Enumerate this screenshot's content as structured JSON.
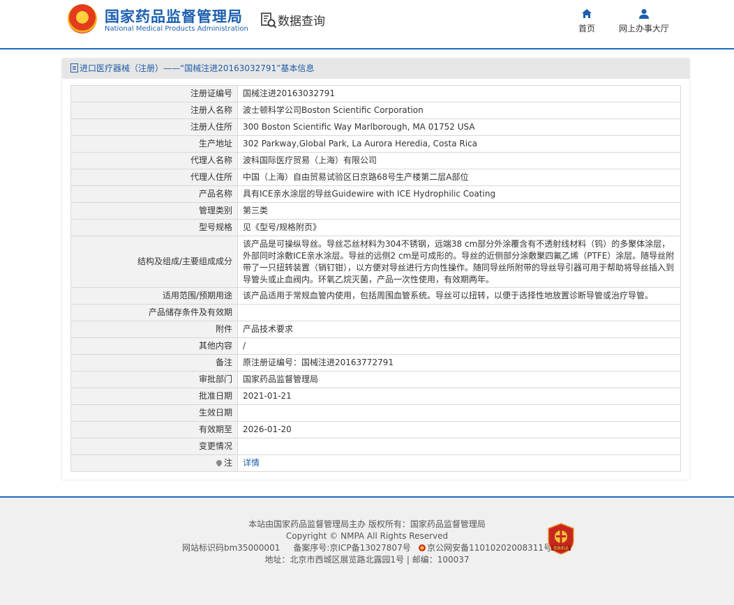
{
  "header": {
    "brand_cn": "国家药品监督管理局",
    "brand_en": "National Medical Products Administration",
    "query_label": "数据查询",
    "nav": [
      {
        "label": "首页",
        "icon": "home-icon"
      },
      {
        "label": "网上办事大厅",
        "icon": "user-icon"
      }
    ]
  },
  "panel": {
    "title": "进口医疗器械（注册）——“国械注进20163032791”基本信息",
    "rows": [
      {
        "label": "注册证编号",
        "value": "国械注进20163032791"
      },
      {
        "label": "注册人名称",
        "value": "波士顿科学公司Boston Scientific Corporation"
      },
      {
        "label": "注册人住所",
        "value": "300 Boston Scientific Way Marlborough, MA 01752 USA"
      },
      {
        "label": "生产地址",
        "value": "302 Parkway,Global Park, La Aurora Heredia, Costa Rica"
      },
      {
        "label": "代理人名称",
        "value": "波科国际医疗贸易（上海）有限公司"
      },
      {
        "label": "代理人住所",
        "value": "中国（上海）自由贸易试验区日京路68号生产楼第二层A部位"
      },
      {
        "label": "产品名称",
        "value": "具有ICE亲水涂层的导丝Guidewire with ICE Hydrophilic Coating"
      },
      {
        "label": "管理类别",
        "value": "第三类"
      },
      {
        "label": "型号规格",
        "value": "见《型号/规格附页》"
      },
      {
        "label": "结构及组成/主要组成成分",
        "value": "该产品是可操纵导丝。导丝芯丝材料为304不锈钢，远端38 cm部分外涂覆含有不透射线材料（钨）的多聚体涂层，外部同时涂敷ICE亲水涂层。导丝的远侧2 cm是可成形的。导丝的近侧部分涂敷聚四氟乙烯（PTFE）涂层。随导丝附带了一只扭转装置（销钉钳），以方便对导丝进行方向性操作。随同导丝所附带的导丝导引器可用于帮助将导丝插入到导管头或止血阀内。环氧乙烷灭菌，产品一次性使用，有效期两年。"
      },
      {
        "label": "适用范围/预期用途",
        "value": "该产品适用于常规血管内使用，包括周围血管系统。导丝可以扭转，以便于选择性地放置诊断导管或治疗导管。"
      },
      {
        "label": "产品储存条件及有效期",
        "value": ""
      },
      {
        "label": "附件",
        "value": "产品技术要求"
      },
      {
        "label": "其他内容",
        "value": "/"
      },
      {
        "label": "备注",
        "value": "原注册证编号：国械注进20163772791"
      },
      {
        "label": "审批部门",
        "value": "国家药品监督管理局"
      },
      {
        "label": "批准日期",
        "value": "2021-01-21"
      },
      {
        "label": "生效日期",
        "value": ""
      },
      {
        "label": "有效期至",
        "value": "2026-01-20"
      },
      {
        "label": "变更情况",
        "value": ""
      }
    ],
    "note_label": "注",
    "note_link": "详情"
  },
  "footer": {
    "line1": "本站由国家药品监督管理局主办 版权所有：国家药品监督管理局",
    "line2": "Copyright © NMPA All Rights Reserved",
    "site_id": "网站标识码bm35000001",
    "icp": "备案序号:京ICP备13027807号",
    "police": "京公网安备11010202008311号",
    "address": "地址：北京市西城区展览路北露园1号 | 邮编：100037",
    "badge_text": "党政机关"
  }
}
